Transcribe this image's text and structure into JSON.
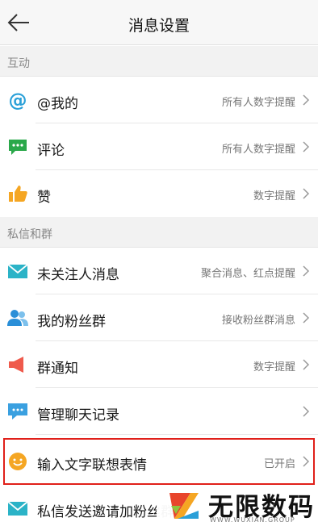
{
  "header": {
    "title": "消息设置"
  },
  "sections": [
    {
      "title": "互动",
      "items": [
        {
          "label": "@我的",
          "value": "所有人数字提醒",
          "icon": "at-icon"
        },
        {
          "label": "评论",
          "value": "所有人数字提醒",
          "icon": "comment-icon"
        },
        {
          "label": "赞",
          "value": "数字提醒",
          "icon": "thumbs-up-icon"
        }
      ]
    },
    {
      "title": "私信和群",
      "items": [
        {
          "label": "未关注人消息",
          "value": "聚合消息、红点提醒",
          "icon": "mail-icon"
        },
        {
          "label": "我的粉丝群",
          "value": "接收粉丝群消息",
          "icon": "group-icon"
        },
        {
          "label": "群通知",
          "value": "数字提醒",
          "icon": "megaphone-icon"
        },
        {
          "label": "管理聊天记录",
          "value": "",
          "icon": "chat-bubble-icon"
        },
        {
          "label": "输入文字联想表情",
          "value": "已开启",
          "icon": "smiley-icon"
        },
        {
          "label": "私信发送邀请加粉丝群",
          "value": "",
          "icon": "mail-icon"
        }
      ]
    }
  ],
  "watermark": {
    "brand": "无限数码",
    "url": "WWW.WUXIAN.GROUP"
  },
  "colors": {
    "icon_blue": "#2aa0d8",
    "icon_green": "#2aa84a",
    "icon_orange": "#f5a623",
    "icon_red": "#ef5a4c",
    "highlight": "#e0201a"
  }
}
